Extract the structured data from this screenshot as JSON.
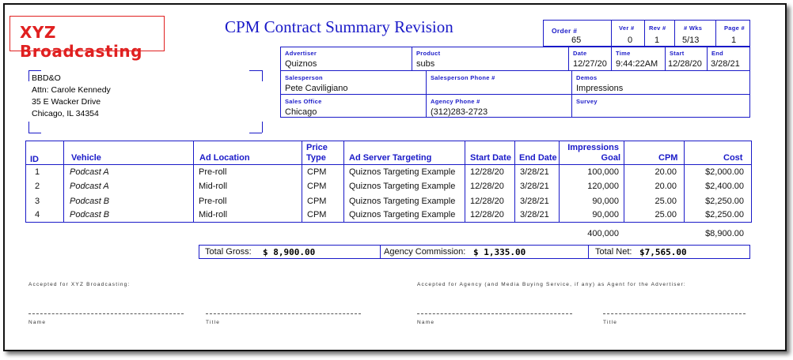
{
  "company": "XYZ Broadcasting",
  "document_title": "CPM Contract Summary Revision",
  "order": {
    "order_label": "Order #",
    "order_value": "65",
    "ver_label": "Ver #",
    "ver_value": "0",
    "rev_label": "Rev #",
    "rev_value": "1",
    "wks_label": "# Wks",
    "wks_value": "5/13",
    "page_label": "Page #",
    "page_value": "1"
  },
  "info": {
    "advertiser_label": "Advertiser",
    "advertiser_value": "Quiznos",
    "product_label": "Product",
    "product_value": "subs",
    "date_label": "Date",
    "date_value": "12/27/20",
    "time_label": "Time",
    "time_value": "9:44:22AM",
    "start_label": "Start",
    "start_value": "12/28/20",
    "end_label": "End",
    "end_value": "3/28/21",
    "salesperson_label": "Salesperson",
    "salesperson_value": "Pete Caviligiano",
    "salesperson_phone_label": "Salesperson Phone #",
    "salesperson_phone_value": "",
    "demos_label": "Demos",
    "demos_value": "Impressions",
    "sales_office_label": "Sales Office",
    "sales_office_value": "Chicago",
    "agency_phone_label": "Agency Phone #",
    "agency_phone_value": "(312)283-2723",
    "survey_label": "Survey",
    "survey_value": ""
  },
  "address": {
    "line1": "BBD&O",
    "line2": "Attn: Carole Kennedy",
    "line3": "35 E Wacker Drive",
    "line4": "Chicago, IL 34354"
  },
  "table": {
    "headers": {
      "id": "ID",
      "vehicle": "Vehicle",
      "ad_location": "Ad Location",
      "price_type_1": "Price",
      "price_type_2": "Type",
      "targeting": "Ad Server Targeting",
      "start_date": "Start Date",
      "end_date": "End Date",
      "impressions_1": "Impressions",
      "impressions_2": "Goal",
      "cpm": "CPM",
      "cost": "Cost"
    },
    "rows": [
      {
        "id": "1",
        "vehicle": "Podcast A",
        "location": "Pre-roll",
        "price_type": "CPM",
        "targeting": "Quiznos Targeting Example",
        "start": "12/28/20",
        "end": "3/28/21",
        "impressions": "100,000",
        "cpm": "20.00",
        "cost": "$2,000.00"
      },
      {
        "id": "2",
        "vehicle": "Podcast A",
        "location": "Mid-roll",
        "price_type": "CPM",
        "targeting": "Quiznos Targeting Example",
        "start": "12/28/20",
        "end": "3/28/21",
        "impressions": "120,000",
        "cpm": "20.00",
        "cost": "$2,400.00"
      },
      {
        "id": "3",
        "vehicle": "Podcast B",
        "location": "Pre-roll",
        "price_type": "CPM",
        "targeting": "Quiznos Targeting Example",
        "start": "12/28/20",
        "end": "3/28/21",
        "impressions": "90,000",
        "cpm": "25.00",
        "cost": "$2,250.00"
      },
      {
        "id": "4",
        "vehicle": "Podcast B",
        "location": "Mid-roll",
        "price_type": "CPM",
        "targeting": "Quiznos Targeting Example",
        "start": "12/28/20",
        "end": "3/28/21",
        "impressions": "90,000",
        "cpm": "25.00",
        "cost": "$2,250.00"
      }
    ],
    "total_impressions": "400,000",
    "total_cost": "$8,900.00"
  },
  "totals": {
    "gross_label": "Total Gross:",
    "gross_value": "$ 8,900.00",
    "commission_label": "Agency Commission:",
    "commission_value": "$ 1,335.00",
    "net_label": "Total Net:",
    "net_value": "$7,565.00"
  },
  "signatures": {
    "accepted_station": "Accepted for XYZ Broadcasting:",
    "accepted_agency": "Accepted for Agency (and Media Buying Service, if any) as Agent for the Advertiser:",
    "name_label": "Name",
    "title_label": "Title"
  }
}
